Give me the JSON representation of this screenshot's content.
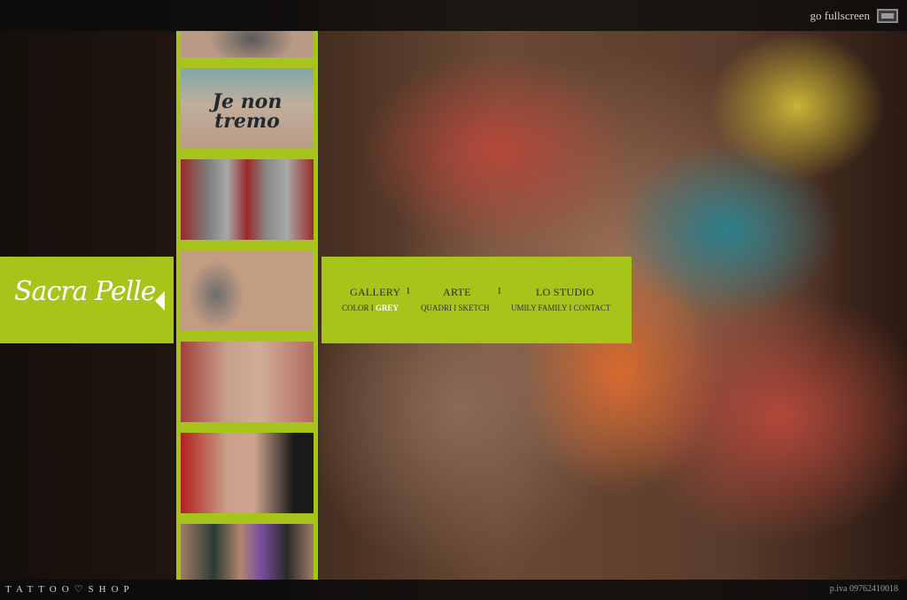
{
  "header": {
    "fullscreen_label": "go fullscreen",
    "fullscreen_icon": "fullscreen-icon"
  },
  "logo": {
    "text": "Sacra Pelle",
    "arrow_icon": "triangle-left-icon"
  },
  "thumbnails": [
    {
      "name": "thumb-1",
      "caption": ""
    },
    {
      "name": "thumb-2",
      "caption": "Je non tremo"
    },
    {
      "name": "thumb-3",
      "caption": ""
    },
    {
      "name": "thumb-4",
      "caption": ""
    },
    {
      "name": "thumb-5",
      "caption": ""
    },
    {
      "name": "thumb-6",
      "caption": ""
    },
    {
      "name": "thumb-7",
      "caption": ""
    }
  ],
  "nav": {
    "sections": [
      {
        "label": "GALLERY",
        "sub": [
          "COLOR",
          "GREY"
        ],
        "active_sub": "GREY"
      },
      {
        "label": "ARTE",
        "sub": [
          "QUADRI",
          "SKETCH"
        ]
      },
      {
        "label": "LO STUDIO",
        "sub": [
          "UMILY FAMILY",
          "CONTACT"
        ]
      }
    ],
    "separator": "I",
    "sub_separator": "I"
  },
  "footer": {
    "brand": "TATTOO♡SHOP",
    "piva": "p.iva 09762410018"
  },
  "colors": {
    "accent": "#a7c41a",
    "bar": "#0c0c0c"
  }
}
